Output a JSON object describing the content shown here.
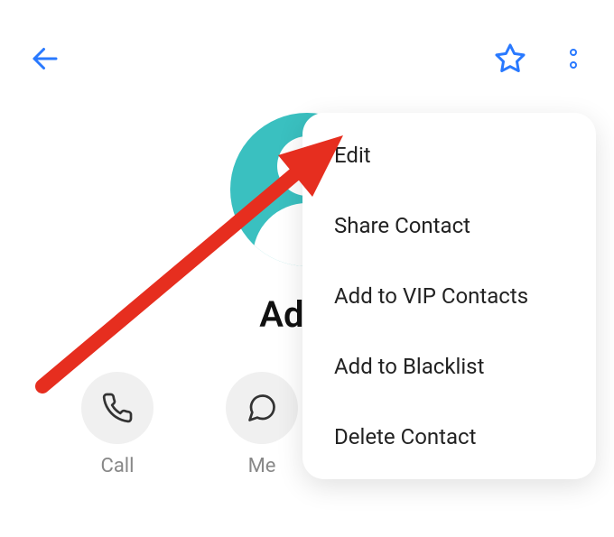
{
  "header": {
    "back_icon": "back-arrow-icon",
    "star_icon": "star-outline-icon",
    "more_icon": "more-vertical-icon"
  },
  "contact": {
    "name": "Adam"
  },
  "actions": {
    "call": {
      "label": "Call",
      "icon": "phone-icon"
    },
    "message": {
      "label": "Me",
      "icon": "message-icon"
    }
  },
  "menu": {
    "items": [
      {
        "label": "Edit"
      },
      {
        "label": "Share Contact"
      },
      {
        "label": "Add to VIP Contacts"
      },
      {
        "label": "Add to Blacklist"
      },
      {
        "label": "Delete Contact"
      }
    ]
  },
  "colors": {
    "accent": "#2979ff",
    "avatar": "#3ac0c0",
    "annotation": "#e62e1f"
  }
}
